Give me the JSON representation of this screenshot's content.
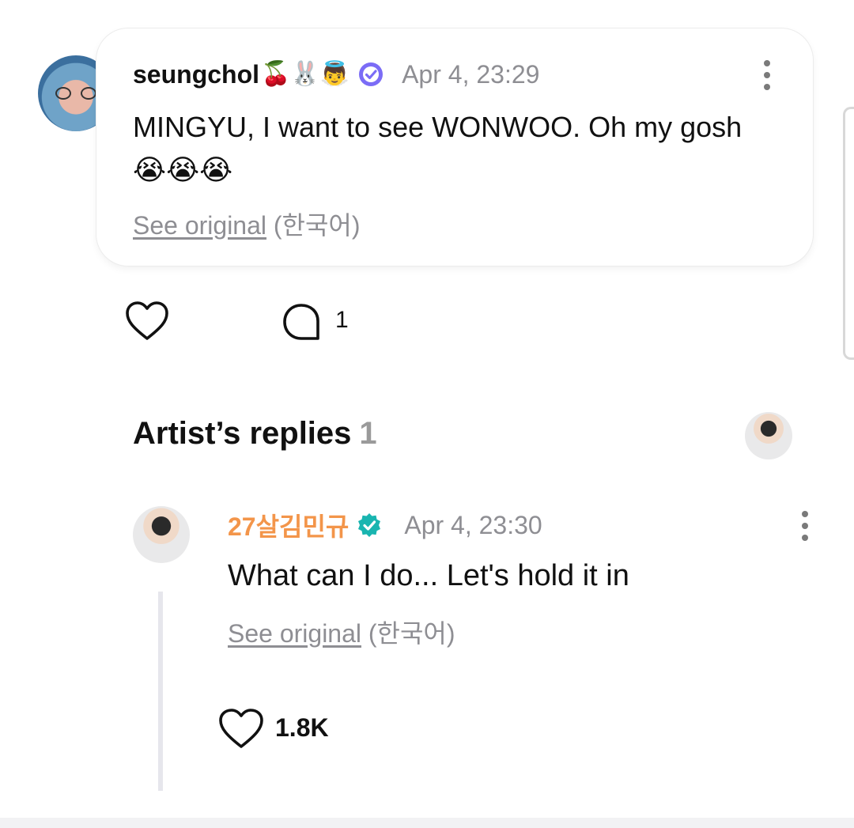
{
  "post": {
    "username": "seungchol",
    "username_emoji": "🍒🐰👼",
    "timestamp": "Apr 4, 23:29",
    "body": "MINGYU, I want to see WONWOO. Oh my gosh 😭😭😭",
    "see_original_label": "See original",
    "original_language": "(한국어)",
    "comment_count": "1",
    "icons": {
      "verified": "verified-badge-icon",
      "like": "heart-icon",
      "comment": "comment-bubble-icon",
      "more": "more-vertical-icon"
    },
    "colors": {
      "verified_badge": "#7b6cf6"
    }
  },
  "replies": {
    "header_label": "Artist’s replies",
    "header_count": "1"
  },
  "reply": {
    "artist_name": "27살김민규",
    "timestamp": "Apr 4, 23:30",
    "body": "What can I do... Let's hold it in",
    "see_original_label": "See original",
    "original_language": "(한국어)",
    "like_count": "1.8K",
    "colors": {
      "artist_name": "#f3954a",
      "verified_badge": "#19b5b0"
    }
  }
}
